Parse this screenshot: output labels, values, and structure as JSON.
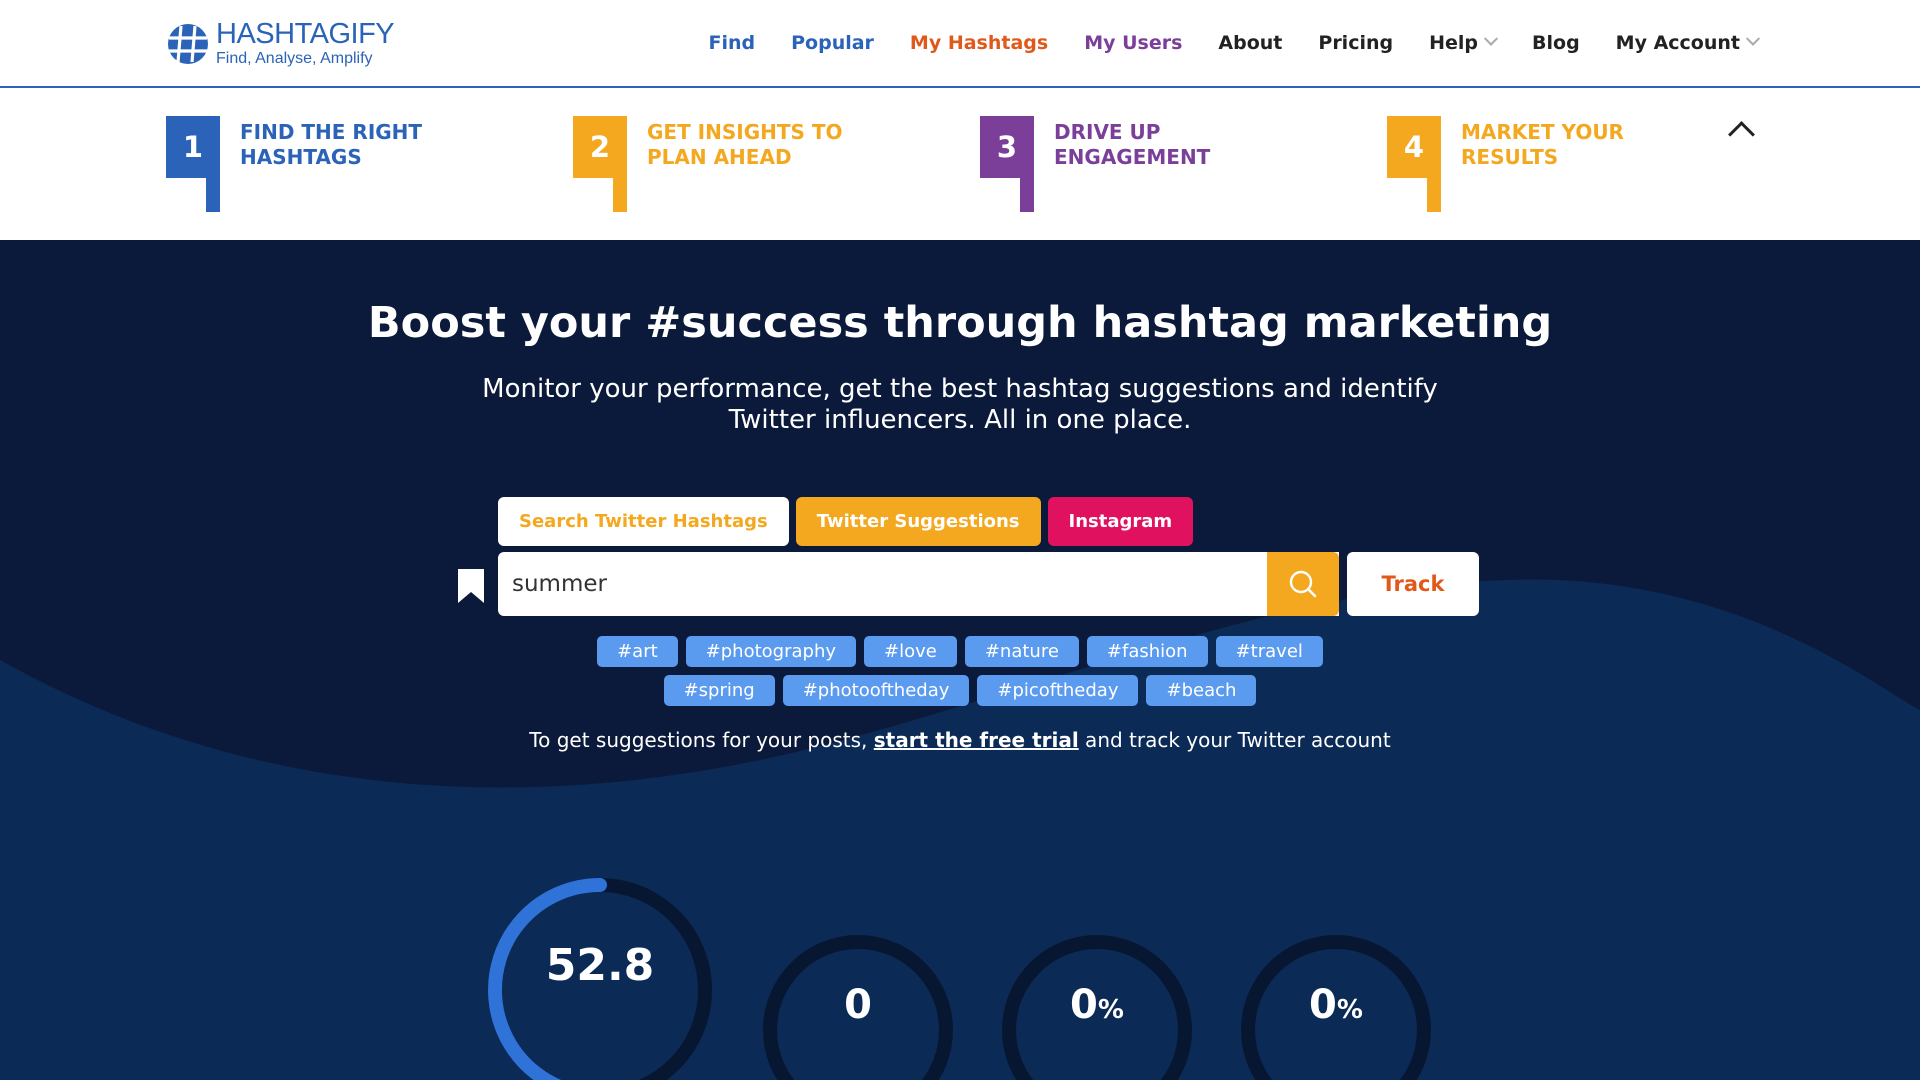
{
  "logo": {
    "name": "HASHTAGIFY",
    "tagline": "Find, Analyse, Amplify",
    "icon": "hashtag-globe-icon"
  },
  "nav": [
    {
      "label": "Find",
      "color": "#2b63b8"
    },
    {
      "label": "Popular",
      "color": "#2b63b8"
    },
    {
      "label": "My Hashtags",
      "color": "#e0591b"
    },
    {
      "label": "My Users",
      "color": "#7b3f9a"
    },
    {
      "label": "About",
      "color": "#222222"
    },
    {
      "label": "Pricing",
      "color": "#222222"
    },
    {
      "label": "Help",
      "color": "#222222"
    },
    {
      "label": "Blog",
      "color": "#222222"
    },
    {
      "label": "My Account",
      "color": "#222222"
    }
  ],
  "steps": [
    {
      "number": "1",
      "title": "Find the right hashtags",
      "color": "#2b63b8"
    },
    {
      "number": "2",
      "title": "Get insights to plan ahead",
      "color": "#f4a81f"
    },
    {
      "number": "3",
      "title": "Drive up engagement",
      "color": "#7b3f9a"
    },
    {
      "number": "4",
      "title": "Market your results",
      "color": "#f4a81f"
    }
  ],
  "hero": {
    "title": "Boost your #success through hashtag marketing",
    "subtitle": "Monitor your performance, get the best hashtag suggestions and identify Twitter influencers. All in one place."
  },
  "tabs": [
    "Search Twitter Hashtags",
    "Twitter Suggestions",
    "Instagram"
  ],
  "search": {
    "value": "summer",
    "placeholder": ""
  },
  "track_label": "Track",
  "tags_row1": [
    "#art",
    "#photography",
    "#love",
    "#nature",
    "#fashion",
    "#travel"
  ],
  "tags_row2": [
    "#spring",
    "#photooftheday",
    "#picoftheday",
    "#beach"
  ],
  "trial": {
    "before": "To get suggestions for your posts, ",
    "link": "start the free trial",
    "after": " and track your Twitter account"
  },
  "gauges": [
    {
      "value": "52.8",
      "unit": "",
      "fraction": 0.528
    },
    {
      "value": "0",
      "unit": "",
      "fraction": 0
    },
    {
      "value": "0",
      "unit": "%",
      "fraction": 0
    },
    {
      "value": "0",
      "unit": "%",
      "fraction": 0
    }
  ],
  "colors": {
    "brand_blue": "#2b63b8",
    "orange": "#f4a81f",
    "magenta": "#e0125f",
    "hero_bg": "#0b1a3a",
    "tag_bg": "#5b9bef"
  }
}
